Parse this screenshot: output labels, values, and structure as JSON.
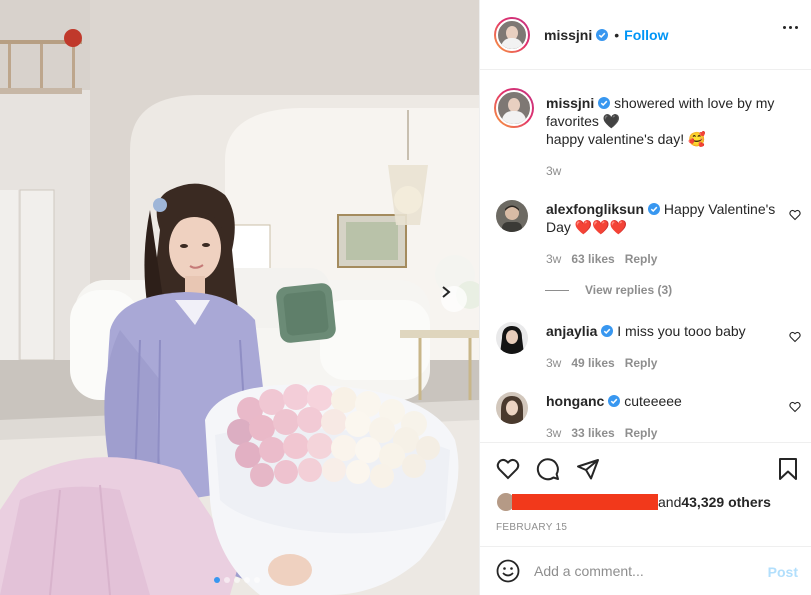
{
  "post": {
    "username": "missjni",
    "verified": true,
    "follow_dot": "•",
    "follow_label": "Follow",
    "more_icon": "ellipsis-icon",
    "caption": "showered with love by my favorites 🖤\nhappy valentine's day! 🥰",
    "caption_time": "3w",
    "carousel": {
      "slides": 5,
      "active_slide": 1
    }
  },
  "comments": [
    {
      "username": "alexfongliksun",
      "verified": true,
      "text": "Happy Valentine's Day ❤️❤️❤️",
      "time": "3w",
      "likes": "63 likes",
      "reply_label": "Reply"
    },
    {
      "username": "anjaylia",
      "verified": true,
      "text": "I miss you tooo baby",
      "time": "3w",
      "likes": "49 likes",
      "reply_label": "Reply"
    },
    {
      "username": "honganc",
      "verified": true,
      "text": "cuteeeee",
      "time": "3w",
      "likes": "33 likes",
      "reply_label": "Reply"
    }
  ],
  "view_replies": "View replies (3)",
  "actions": {
    "icons": [
      "heart-icon",
      "comment-icon",
      "share-icon",
      "bookmark-icon"
    ]
  },
  "likes": {
    "prefix": "and ",
    "count": "43,329 others"
  },
  "date": "FEBRUARY 15",
  "add_comment": {
    "placeholder": "Add a comment...",
    "post_label": "Post",
    "emoji_icon": "smiley-icon"
  },
  "colors": {
    "accent": "#0095f6",
    "verified": "#3897f0",
    "redaction": "#f2391b",
    "muted": "#8e8e8e"
  }
}
